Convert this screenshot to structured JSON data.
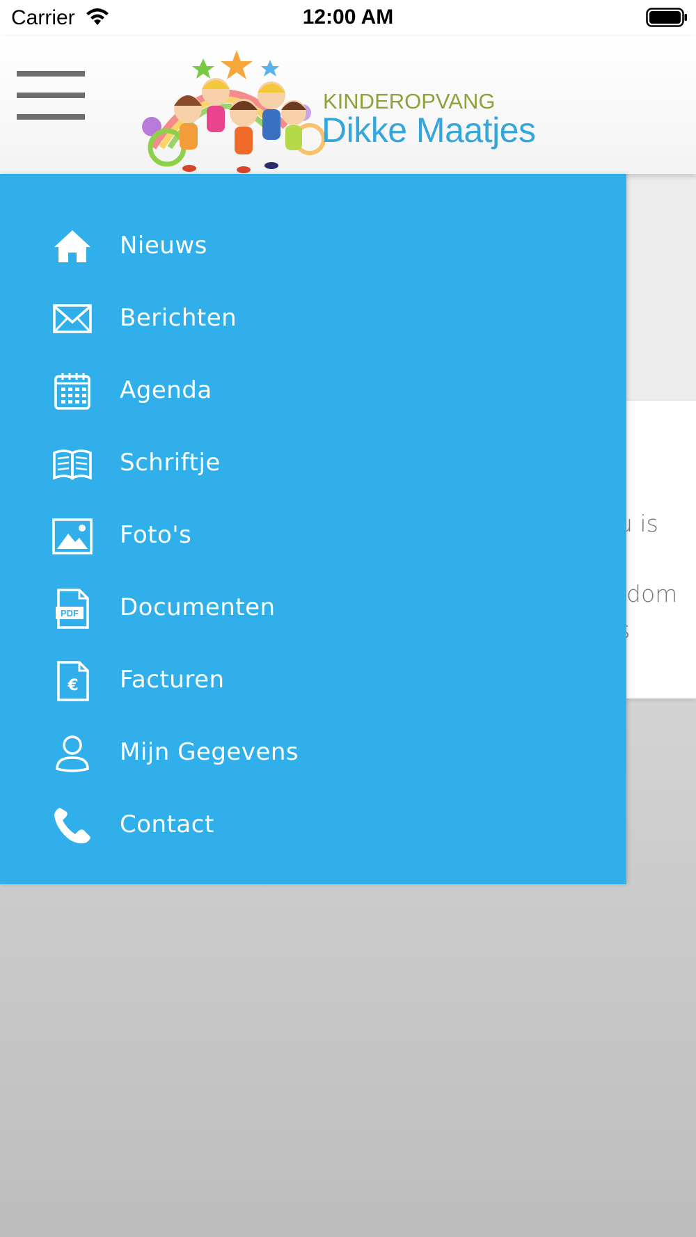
{
  "status_bar": {
    "carrier": "Carrier",
    "time": "12:00 AM"
  },
  "header": {
    "logo": {
      "kicker": "KINDEROPVANG",
      "name": "Dikke Maatjes"
    },
    "menu_icon": "hamburger-icon"
  },
  "background": {
    "fragments": [
      "u is",
      "dom",
      "s"
    ]
  },
  "drawer": {
    "color": "#30afea",
    "items": [
      {
        "label": "Nieuws",
        "icon": "home-icon"
      },
      {
        "label": "Berichten",
        "icon": "envelope-icon"
      },
      {
        "label": "Agenda",
        "icon": "calendar-icon"
      },
      {
        "label": "Schriftje",
        "icon": "book-icon"
      },
      {
        "label": "Foto's",
        "icon": "image-icon"
      },
      {
        "label": "Documenten",
        "icon": "pdf-file-icon"
      },
      {
        "label": "Facturen",
        "icon": "invoice-euro-icon"
      },
      {
        "label": "Mijn Gegevens",
        "icon": "user-icon"
      },
      {
        "label": "Contact",
        "icon": "phone-icon"
      }
    ]
  }
}
